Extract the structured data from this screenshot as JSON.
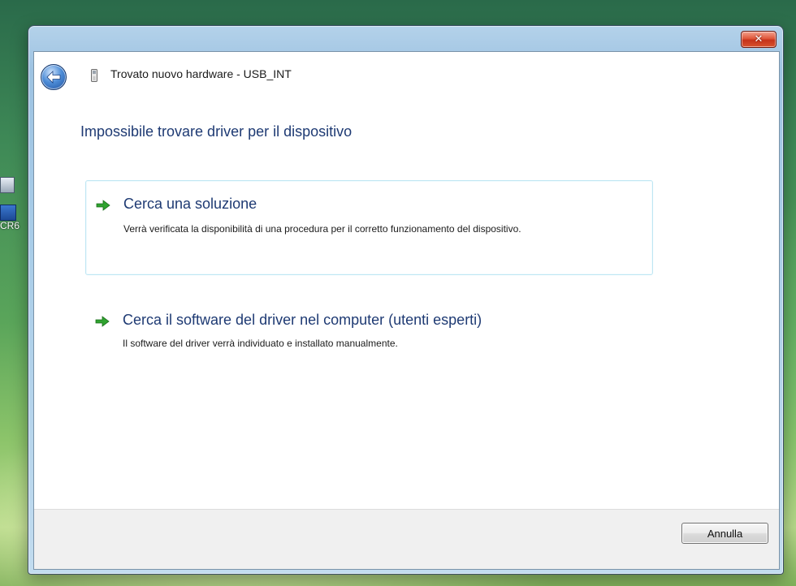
{
  "desktop": {
    "icon_label": "CR6"
  },
  "window": {
    "title": "Trovato nuovo hardware - USB_INT",
    "close_label": "✕"
  },
  "main": {
    "heading": "Impossibile trovare driver per il dispositivo",
    "options": [
      {
        "title": "Cerca una soluzione",
        "description": "Verrà verificata la disponibilità di una procedura per il corretto funzionamento del dispositivo."
      },
      {
        "title": "Cerca il software del driver nel computer (utenti esperti)",
        "description": "Il software del driver verrà individuato e installato manualmente."
      }
    ]
  },
  "footer": {
    "cancel_label": "Annulla"
  },
  "colors": {
    "heading": "#1e3a73",
    "arrow": "#2fa32f",
    "selection_border": "#bfe6f3",
    "close_button": "#d8532f"
  },
  "icons": {
    "back": "back-arrow-icon",
    "device": "usb-device-icon",
    "option": "green-arrow-icon",
    "close": "close-icon"
  }
}
